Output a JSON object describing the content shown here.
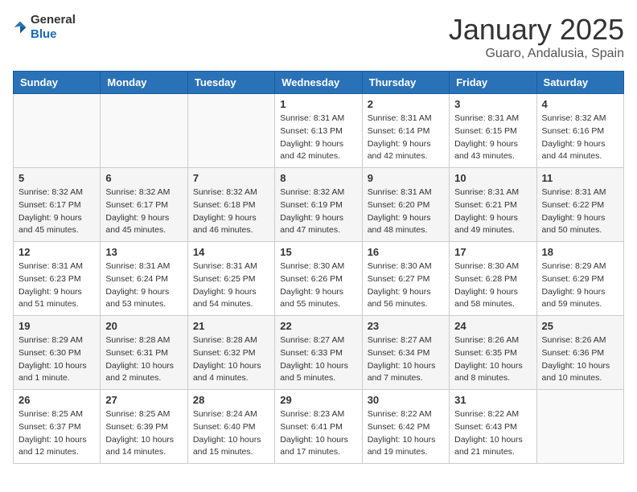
{
  "header": {
    "logo_general": "General",
    "logo_blue": "Blue",
    "title": "January 2025",
    "subtitle": "Guaro, Andalusia, Spain"
  },
  "columns": [
    "Sunday",
    "Monday",
    "Tuesday",
    "Wednesday",
    "Thursday",
    "Friday",
    "Saturday"
  ],
  "weeks": [
    [
      {
        "day": "",
        "info": ""
      },
      {
        "day": "",
        "info": ""
      },
      {
        "day": "",
        "info": ""
      },
      {
        "day": "1",
        "info": "Sunrise: 8:31 AM\nSunset: 6:13 PM\nDaylight: 9 hours\nand 42 minutes."
      },
      {
        "day": "2",
        "info": "Sunrise: 8:31 AM\nSunset: 6:14 PM\nDaylight: 9 hours\nand 42 minutes."
      },
      {
        "day": "3",
        "info": "Sunrise: 8:31 AM\nSunset: 6:15 PM\nDaylight: 9 hours\nand 43 minutes."
      },
      {
        "day": "4",
        "info": "Sunrise: 8:32 AM\nSunset: 6:16 PM\nDaylight: 9 hours\nand 44 minutes."
      }
    ],
    [
      {
        "day": "5",
        "info": "Sunrise: 8:32 AM\nSunset: 6:17 PM\nDaylight: 9 hours\nand 45 minutes."
      },
      {
        "day": "6",
        "info": "Sunrise: 8:32 AM\nSunset: 6:17 PM\nDaylight: 9 hours\nand 45 minutes."
      },
      {
        "day": "7",
        "info": "Sunrise: 8:32 AM\nSunset: 6:18 PM\nDaylight: 9 hours\nand 46 minutes."
      },
      {
        "day": "8",
        "info": "Sunrise: 8:32 AM\nSunset: 6:19 PM\nDaylight: 9 hours\nand 47 minutes."
      },
      {
        "day": "9",
        "info": "Sunrise: 8:31 AM\nSunset: 6:20 PM\nDaylight: 9 hours\nand 48 minutes."
      },
      {
        "day": "10",
        "info": "Sunrise: 8:31 AM\nSunset: 6:21 PM\nDaylight: 9 hours\nand 49 minutes."
      },
      {
        "day": "11",
        "info": "Sunrise: 8:31 AM\nSunset: 6:22 PM\nDaylight: 9 hours\nand 50 minutes."
      }
    ],
    [
      {
        "day": "12",
        "info": "Sunrise: 8:31 AM\nSunset: 6:23 PM\nDaylight: 9 hours\nand 51 minutes."
      },
      {
        "day": "13",
        "info": "Sunrise: 8:31 AM\nSunset: 6:24 PM\nDaylight: 9 hours\nand 53 minutes."
      },
      {
        "day": "14",
        "info": "Sunrise: 8:31 AM\nSunset: 6:25 PM\nDaylight: 9 hours\nand 54 minutes."
      },
      {
        "day": "15",
        "info": "Sunrise: 8:30 AM\nSunset: 6:26 PM\nDaylight: 9 hours\nand 55 minutes."
      },
      {
        "day": "16",
        "info": "Sunrise: 8:30 AM\nSunset: 6:27 PM\nDaylight: 9 hours\nand 56 minutes."
      },
      {
        "day": "17",
        "info": "Sunrise: 8:30 AM\nSunset: 6:28 PM\nDaylight: 9 hours\nand 58 minutes."
      },
      {
        "day": "18",
        "info": "Sunrise: 8:29 AM\nSunset: 6:29 PM\nDaylight: 9 hours\nand 59 minutes."
      }
    ],
    [
      {
        "day": "19",
        "info": "Sunrise: 8:29 AM\nSunset: 6:30 PM\nDaylight: 10 hours\nand 1 minute."
      },
      {
        "day": "20",
        "info": "Sunrise: 8:28 AM\nSunset: 6:31 PM\nDaylight: 10 hours\nand 2 minutes."
      },
      {
        "day": "21",
        "info": "Sunrise: 8:28 AM\nSunset: 6:32 PM\nDaylight: 10 hours\nand 4 minutes."
      },
      {
        "day": "22",
        "info": "Sunrise: 8:27 AM\nSunset: 6:33 PM\nDaylight: 10 hours\nand 5 minutes."
      },
      {
        "day": "23",
        "info": "Sunrise: 8:27 AM\nSunset: 6:34 PM\nDaylight: 10 hours\nand 7 minutes."
      },
      {
        "day": "24",
        "info": "Sunrise: 8:26 AM\nSunset: 6:35 PM\nDaylight: 10 hours\nand 8 minutes."
      },
      {
        "day": "25",
        "info": "Sunrise: 8:26 AM\nSunset: 6:36 PM\nDaylight: 10 hours\nand 10 minutes."
      }
    ],
    [
      {
        "day": "26",
        "info": "Sunrise: 8:25 AM\nSunset: 6:37 PM\nDaylight: 10 hours\nand 12 minutes."
      },
      {
        "day": "27",
        "info": "Sunrise: 8:25 AM\nSunset: 6:39 PM\nDaylight: 10 hours\nand 14 minutes."
      },
      {
        "day": "28",
        "info": "Sunrise: 8:24 AM\nSunset: 6:40 PM\nDaylight: 10 hours\nand 15 minutes."
      },
      {
        "day": "29",
        "info": "Sunrise: 8:23 AM\nSunset: 6:41 PM\nDaylight: 10 hours\nand 17 minutes."
      },
      {
        "day": "30",
        "info": "Sunrise: 8:22 AM\nSunset: 6:42 PM\nDaylight: 10 hours\nand 19 minutes."
      },
      {
        "day": "31",
        "info": "Sunrise: 8:22 AM\nSunset: 6:43 PM\nDaylight: 10 hours\nand 21 minutes."
      },
      {
        "day": "",
        "info": ""
      }
    ]
  ]
}
